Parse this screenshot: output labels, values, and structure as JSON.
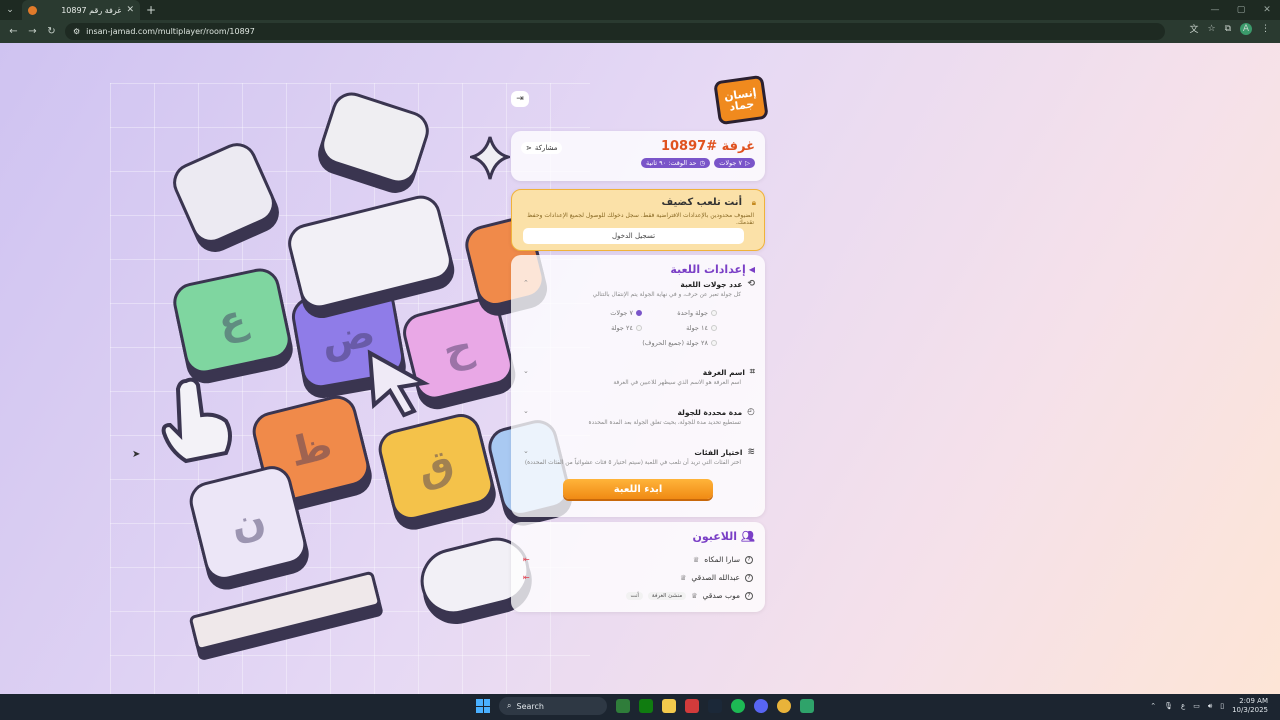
{
  "browser": {
    "tab_title": "غرفة رقم 10897",
    "url": "insan-jamad.com/multiplayer/room/10897"
  },
  "room": {
    "title": "غرفة #10897",
    "share_label": "مشاركة",
    "chip_rounds": "٧ جولات",
    "chip_time": "حد الوقت: ٩٠ ثانية"
  },
  "guest": {
    "title": "أنت تلعب كضيف",
    "desc": "الضيوف محدودين بالإعدادات الافتراضية فقط. سجل دخولك للوصول لجميع الإعدادات وحفظ تقدمك.",
    "login_label": "تسجيل الدخول"
  },
  "settings": {
    "title": "إعدادات اللعبة",
    "rounds": {
      "title": "عدد جولات اللعبة",
      "desc": "كل جولة تعبر عن حرف، و في نهاية الجولة يتم الإنتقال بالتتالي",
      "options": [
        "جولة واحدة",
        "٧ جولات",
        "١٤ جولة",
        "٢٤ جولة",
        "٢٨ جولة (جميع الحروف)"
      ],
      "selected": "٧ جولات"
    },
    "room_name": {
      "title": "اسم الغرفة",
      "desc": "اسم الغرفة هو الاسم الذي سيظهر للاعبين في الغرفة"
    },
    "round_time": {
      "title": "مدة محددة للجولة",
      "desc": "تستطيع تحديد مدة للجولة، بحيث تغلق الجولة بعد المدة المحددة"
    },
    "categories": {
      "title": "اختيار الفئات",
      "desc": "اختر الفئات التي تريد أن تلعب في اللعبة (سيتم اختيار ٥ فئات عشوائياً من الفئات المحددة)"
    },
    "start_label": "ابدء اللعبة"
  },
  "players": {
    "title": "اللاعبون",
    "list": [
      {
        "name": "سارا المكاه"
      },
      {
        "name": "عبدالله الصدقي"
      },
      {
        "name": "موب صدقي",
        "tag_host": "منشئ الغرفة",
        "tag_you": "أنت"
      }
    ]
  },
  "logo_text": "إنسان جماد",
  "keys": [
    "ع",
    "ض",
    "ح",
    "ظ",
    "ق",
    "ن"
  ],
  "taskbar": {
    "search_label": "Search",
    "lang": "ع",
    "time": "2:09 AM",
    "date": "10/3/2025"
  },
  "colors": {
    "accent_purple": "#7a3fc6",
    "orange": "#f08a14",
    "title_orange": "#e0521f"
  }
}
